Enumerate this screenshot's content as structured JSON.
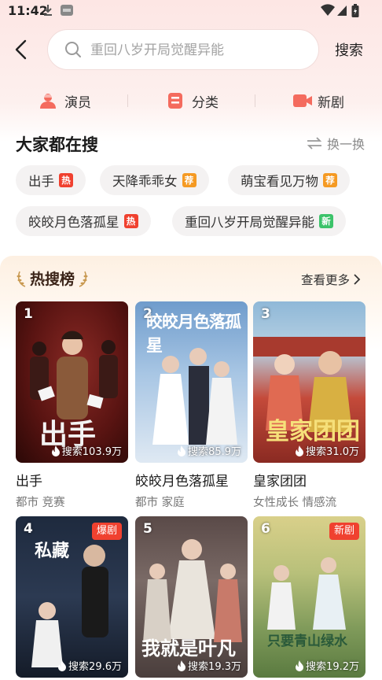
{
  "status": {
    "time": "11:42"
  },
  "search": {
    "placeholder": "重回八岁开局觉醒异能",
    "button_label": "搜索"
  },
  "categories": [
    {
      "label": "演员",
      "icon": "actor-icon"
    },
    {
      "label": "分类",
      "icon": "category-icon"
    },
    {
      "label": "新剧",
      "icon": "new-drama-icon"
    }
  ],
  "trending_section": {
    "title": "大家都在搜",
    "refresh_label": "换一换",
    "chips": [
      {
        "label": "出手",
        "badge": "热"
      },
      {
        "label": "天降乖乖女",
        "badge": "荐"
      },
      {
        "label": "萌宝看见万物",
        "badge": "荐"
      },
      {
        "label": "皎皎月色落孤星",
        "badge": "热"
      },
      {
        "label": "重回八岁开局觉醒异能",
        "badge": "新"
      }
    ]
  },
  "hot_list": {
    "title": "热搜榜",
    "more_label": "查看更多",
    "items": [
      {
        "rank": "1",
        "title": "出手",
        "genre": "都市 竞赛",
        "search_count": "搜索103.9万",
        "poster_text": "出手",
        "tag": ""
      },
      {
        "rank": "2",
        "title": "皎皎月色落孤星",
        "genre": "都市 家庭",
        "search_count": "搜索85.9万",
        "poster_text": "皎皎月色落孤星",
        "tag": ""
      },
      {
        "rank": "3",
        "title": "皇家团团",
        "genre": "女性成长 情感流",
        "search_count": "搜索31.0万",
        "poster_text": "皇家团团",
        "tag": ""
      },
      {
        "rank": "4",
        "title": "",
        "genre": "",
        "search_count": "搜索29.6万",
        "poster_text": "私藏",
        "tag": "爆剧"
      },
      {
        "rank": "5",
        "title": "",
        "genre": "",
        "search_count": "搜索19.3万",
        "poster_text": "我就是叶凡",
        "tag": ""
      },
      {
        "rank": "6",
        "title": "",
        "genre": "",
        "search_count": "搜索19.2万",
        "poster_text": "只要青山绿水",
        "tag": "新剧"
      }
    ]
  },
  "colors": {
    "hot_badge": "#f0412f",
    "rec_badge": "#f59a23",
    "new_badge": "#3cc36a",
    "accent_red": "#f0412f"
  }
}
